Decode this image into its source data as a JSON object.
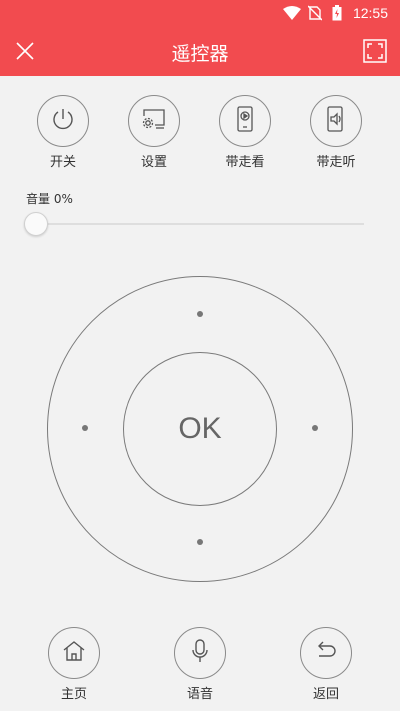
{
  "status_bar": {
    "time": "12:55"
  },
  "header": {
    "title": "遥控器"
  },
  "top_buttons": [
    {
      "label": "开关",
      "icon": "power-icon"
    },
    {
      "label": "设置",
      "icon": "settings-screen-icon"
    },
    {
      "label": "带走看",
      "icon": "phone-play-icon"
    },
    {
      "label": "带走听",
      "icon": "phone-audio-icon"
    }
  ],
  "volume": {
    "label": "音量 0%",
    "level": 0
  },
  "dpad": {
    "ok_label": "OK"
  },
  "bottom_buttons": [
    {
      "label": "主页",
      "icon": "home-icon"
    },
    {
      "label": "语音",
      "icon": "microphone-icon"
    },
    {
      "label": "返回",
      "icon": "back-icon"
    }
  ],
  "colors": {
    "header": "#f24b4f",
    "background": "#f2f2f2",
    "outline": "#7a7a7a"
  }
}
